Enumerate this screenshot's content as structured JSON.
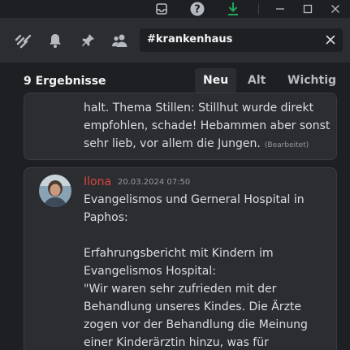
{
  "titlebar": {
    "icons": [
      "inbox-icon",
      "help-icon",
      "download-icon",
      "minimize-icon",
      "maximize-icon",
      "close-icon"
    ],
    "download_color": "#23a55a"
  },
  "toolbar": {
    "icons": [
      "threads-icon",
      "bell-icon",
      "pin-icon",
      "members-icon"
    ]
  },
  "search": {
    "query": "#krankenhaus"
  },
  "results": {
    "count_label": "9 Ergebnisse",
    "tabs": [
      {
        "label": "Neu",
        "active": true
      },
      {
        "label": "Alt",
        "active": false
      },
      {
        "label": "Wichtig",
        "active": false
      }
    ]
  },
  "messages": [
    {
      "text": "halt. Thema Stillen: Stillhut wurde direkt\nempfohlen, schade! Hebammen aber sonst\nsehr lieb, vor allem die Jungen.",
      "edited": "(Bearbeitet)"
    },
    {
      "author": "Ilona",
      "author_color": "#d9453f",
      "timestamp": "20.03.2024 07:50",
      "text": "Evangelismos und Gerneral Hospital in\nPaphos:\n\nErfahrungsbericht mit Kindern im\nEvangelismos Hospital:\n\"Wir waren sehr zufrieden mit der\nBehandlung unseres Kindes. Die Ärzte\nzogen vor der Behandlung die Meinung\neiner Kinderärztin hinzu, was für"
    }
  ]
}
